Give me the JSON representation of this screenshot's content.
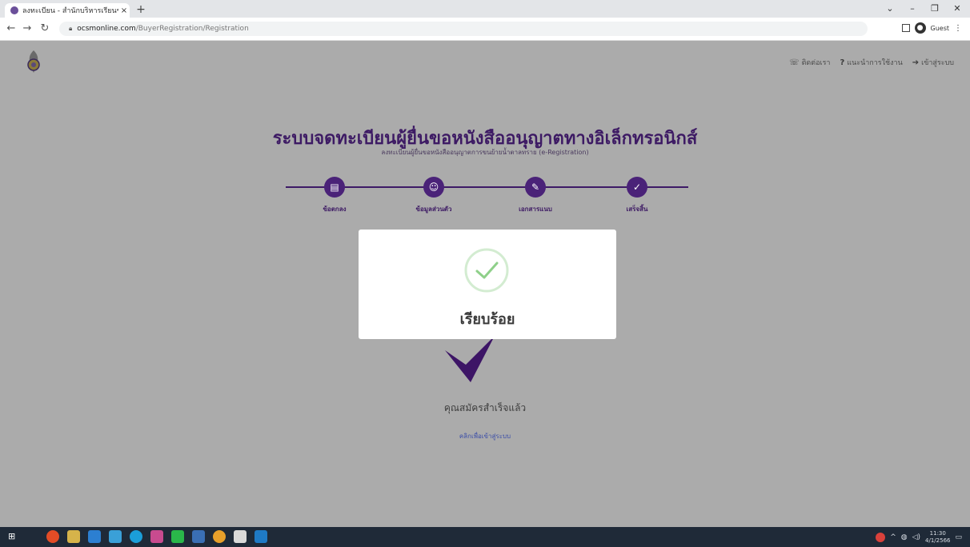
{
  "browser": {
    "tab_title": "ลงทะเบียน - สำนักบริหารเรียนขอหนังสือ",
    "tab_close": "×",
    "new_tab": "+",
    "url_host": "ocsmonline.com",
    "url_path": "/BuyerRegistration/Registration",
    "guest_label": "Guest",
    "window_controls": [
      "⌄",
      "–",
      "❐",
      "✕"
    ]
  },
  "header": {
    "links": [
      {
        "icon": "phone-icon",
        "glyph": "☏",
        "label": "ติดต่อเรา"
      },
      {
        "icon": "help-icon",
        "glyph": "?",
        "label": "แนะนำการใช้งาน"
      },
      {
        "icon": "login-icon",
        "glyph": "➔",
        "label": "เข้าสู่ระบบ"
      }
    ]
  },
  "page": {
    "title": "ระบบจดทะเบียนผู้ยื่นขอหนังสืออนุญาตทางอิเล็กทรอนิกส์",
    "subtitle": "ลงทะเบียนผู้ยื่นขอหนังสืออนุญาตการขนย้ายน้ำตาลทราย (e-Registration)",
    "steps": [
      {
        "icon": "document-icon",
        "glyph": "▤",
        "label": "ข้อตกลง"
      },
      {
        "icon": "user-icon",
        "glyph": "☺",
        "label": "ข้อมูลส่วนตัว"
      },
      {
        "icon": "attachment-icon",
        "glyph": "✎",
        "label": "เอกสารแนบ"
      },
      {
        "icon": "check-icon",
        "glyph": "✓",
        "label": "เสร็จสิ้น"
      }
    ],
    "done_text": "คุณสมัครสำเร็จแล้ว",
    "login_link": "คลิกเพื่อเข้าสู่ระบบ"
  },
  "modal": {
    "message": "เรียบร้อย"
  },
  "taskbar": {
    "time": "11:30",
    "date": "4/1/2566"
  },
  "colors": {
    "primary": "#4a2278",
    "overlay": "#ababab",
    "success": "#8fd08a"
  }
}
